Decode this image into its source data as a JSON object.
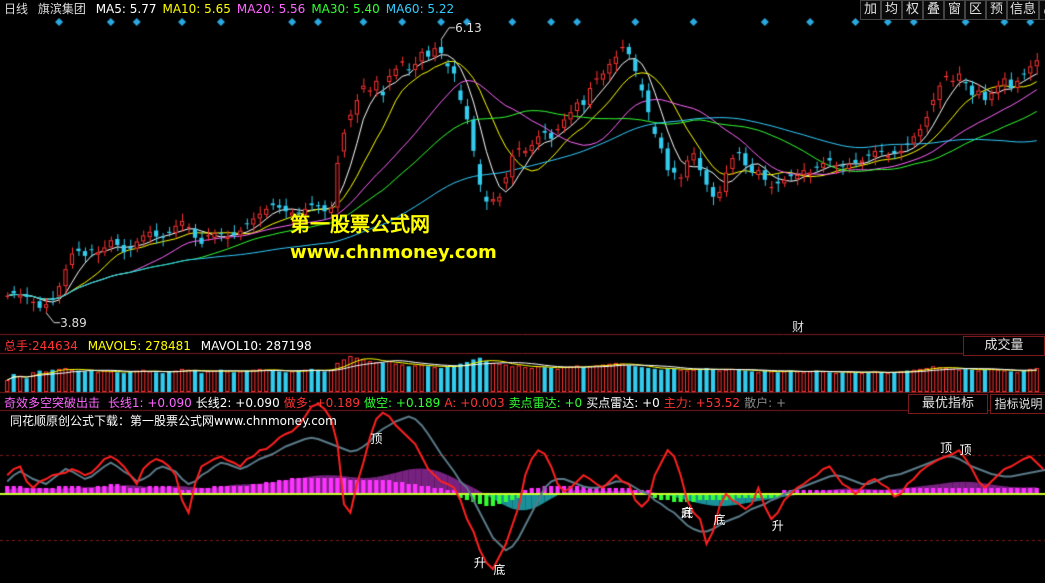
{
  "header": {
    "period": "日线",
    "stock_name": "旗滨集团",
    "ma": [
      {
        "label": "MA5:",
        "value": "5.77",
        "color": "#ffffff"
      },
      {
        "label": "MA10:",
        "value": "5.65",
        "color": "#ffff00"
      },
      {
        "label": "MA20:",
        "value": "5.56",
        "color": "#ff66ff"
      },
      {
        "label": "MA30:",
        "value": "5.40",
        "color": "#33ff33"
      },
      {
        "label": "MA60:",
        "value": "5.22",
        "color": "#33ccff"
      }
    ],
    "toolbar": [
      "加",
      "均",
      "权",
      "叠",
      "窗",
      "区",
      "预",
      "信息"
    ],
    "expand_icon": "expand-icon"
  },
  "price_panel": {
    "high_label": "6.13",
    "low_label": "3.89",
    "fin_marker": "财"
  },
  "watermark": {
    "line1": "第一股票公式网",
    "line2": "www.chnmoney.com"
  },
  "volume_header": {
    "total_label": "总手:",
    "total_value": "244634",
    "mavol5_label": "MAVOL5:",
    "mavol5_value": "278481",
    "mavol10_label": "MAVOL10:",
    "mavol10_value": "287198",
    "button": "成交量"
  },
  "indicator_header": {
    "name": "奇效多空突破出击",
    "items": [
      {
        "label": "长线1:",
        "value": "+0.090",
        "color": "#ff66ff"
      },
      {
        "label": "长线2:",
        "value": "+0.090",
        "color": "#ffffff"
      },
      {
        "label": "做多:",
        "value": "+0.189",
        "color": "#ff3333"
      },
      {
        "label": "做空:",
        "value": "+0.189",
        "color": "#33ff33"
      },
      {
        "label": "A:",
        "value": "+0.003",
        "color": "#ff3333"
      },
      {
        "label": "卖点雷达:",
        "value": "+0",
        "color": "#33ff33"
      },
      {
        "label": "买点雷达:",
        "value": "+0",
        "color": "#ffffff"
      },
      {
        "label": "主力:",
        "value": "+53.52",
        "color": "#ff3333"
      },
      {
        "label": "散户:",
        "value": "+",
        "color": "#888888"
      }
    ],
    "btn_best": "最优指标",
    "btn_explain": "指标说明"
  },
  "indicator_note": "同花顺原创公式下载：第一股票公式网www.chnmoney.com",
  "signals": [
    {
      "text": "顶",
      "i": 57
    },
    {
      "text": "升",
      "i": 73
    },
    {
      "text": "底",
      "i": 76
    },
    {
      "text": "升",
      "i": 105
    },
    {
      "text": "底",
      "i": 105
    },
    {
      "text": "底",
      "i": 110
    },
    {
      "text": "升",
      "i": 119
    },
    {
      "text": "顶",
      "i": 145
    },
    {
      "text": "顶",
      "i": 148
    }
  ],
  "chart_data": {
    "type": "candlestick",
    "up_color": "#ff3333",
    "down_color": "#33ccee",
    "x_count": 160,
    "ylim": [
      3.7,
      6.3
    ],
    "close": [
      4.0,
      4.02,
      4.01,
      3.99,
      3.95,
      3.9,
      3.93,
      3.97,
      4.08,
      4.22,
      4.35,
      4.37,
      4.33,
      4.38,
      4.36,
      4.4,
      4.46,
      4.42,
      4.36,
      4.39,
      4.45,
      4.5,
      4.53,
      4.49,
      4.48,
      4.52,
      4.58,
      4.62,
      4.57,
      4.48,
      4.43,
      4.5,
      4.52,
      4.51,
      4.49,
      4.5,
      4.54,
      4.6,
      4.64,
      4.68,
      4.72,
      4.75,
      4.73,
      4.7,
      4.69,
      4.68,
      4.72,
      4.75,
      4.74,
      4.7,
      4.73,
      5.1,
      5.35,
      5.5,
      5.62,
      5.74,
      5.7,
      5.78,
      5.66,
      5.82,
      5.88,
      5.94,
      5.87,
      5.92,
      6.02,
      5.98,
      6.05,
      6.01,
      5.9,
      5.84,
      5.62,
      5.46,
      5.2,
      4.92,
      4.78,
      4.8,
      4.82,
      4.98,
      5.16,
      5.22,
      5.2,
      5.25,
      5.32,
      5.35,
      5.3,
      5.38,
      5.46,
      5.52,
      5.6,
      5.58,
      5.72,
      5.8,
      5.84,
      5.92,
      5.98,
      6.06,
      6.0,
      5.86,
      5.7,
      5.52,
      5.34,
      5.22,
      5.04,
      5.02,
      4.98,
      5.12,
      5.18,
      5.04,
      4.92,
      4.82,
      4.86,
      5.02,
      5.14,
      5.18,
      5.08,
      5.02,
      5.04,
      4.96,
      4.9,
      4.93,
      4.96,
      4.99,
      5.0,
      5.04,
      5.02,
      5.06,
      5.1,
      5.12,
      5.08,
      5.07,
      5.09,
      5.1,
      5.12,
      5.16,
      5.2,
      5.19,
      5.16,
      5.18,
      5.2,
      5.26,
      5.32,
      5.38,
      5.48,
      5.62,
      5.74,
      5.82,
      5.78,
      5.84,
      5.76,
      5.66,
      5.7,
      5.62,
      5.68,
      5.74,
      5.8,
      5.72,
      5.78,
      5.84,
      5.9,
      5.95
    ],
    "ma_windows": [
      5,
      10,
      20,
      30,
      60
    ],
    "ma_colors": [
      "#ffffff",
      "#ffff00",
      "#ff66ff",
      "#33ff33",
      "#33ccff"
    ],
    "volume": [
      140,
      210,
      190,
      160,
      230,
      250,
      240,
      260,
      270,
      280,
      260,
      250,
      240,
      250,
      230,
      250,
      240,
      230,
      220,
      240,
      250,
      260,
      240,
      230,
      220,
      240,
      250,
      270,
      260,
      250,
      220,
      240,
      250,
      260,
      240,
      230,
      240,
      250,
      260,
      270,
      260,
      250,
      240,
      230,
      240,
      250,
      260,
      270,
      250,
      240,
      260,
      340,
      380,
      420,
      400,
      380,
      360,
      350,
      340,
      360,
      330,
      320,
      300,
      310,
      320,
      300,
      290,
      280,
      300,
      310,
      330,
      350,
      380,
      400,
      360,
      340,
      330,
      320,
      300,
      310,
      290,
      280,
      300,
      290,
      280,
      270,
      290,
      300,
      310,
      290,
      300,
      310,
      320,
      330,
      340,
      330,
      310,
      300,
      290,
      280,
      270,
      260,
      280,
      270,
      260,
      250,
      260,
      270,
      280,
      260,
      250,
      260,
      270,
      260,
      250,
      240,
      230,
      250,
      240,
      230,
      240,
      250,
      240,
      230,
      240,
      250,
      240,
      230,
      220,
      230,
      240,
      230,
      220,
      230,
      240,
      230,
      220,
      230,
      240,
      250,
      260,
      270,
      280,
      300,
      290,
      280,
      270,
      260,
      270,
      260,
      250,
      260,
      270,
      260,
      250,
      240,
      230,
      250,
      270,
      280
    ],
    "indicator": {
      "red_line": [
        15,
        20,
        22,
        10,
        5,
        10,
        12,
        15,
        16,
        17,
        20,
        18,
        15,
        17,
        22,
        28,
        30,
        27,
        22,
        15,
        8,
        20,
        25,
        28,
        26,
        22,
        15,
        -5,
        -15,
        8,
        22,
        25,
        28,
        30,
        27,
        25,
        22,
        28,
        30,
        35,
        36,
        40,
        45,
        48,
        50,
        55,
        62,
        70,
        72,
        68,
        60,
        40,
        -8,
        -15,
        8,
        25,
        45,
        60,
        65,
        62,
        55,
        50,
        45,
        40,
        30,
        20,
        15,
        10,
        8,
        5,
        -5,
        -20,
        -30,
        -45,
        -55,
        -60,
        -50,
        -40,
        -25,
        -10,
        15,
        28,
        35,
        32,
        22,
        8,
        2,
        5,
        10,
        15,
        12,
        8,
        5,
        10,
        15,
        10,
        8,
        -5,
        -10,
        -5,
        15,
        25,
        35,
        30,
        15,
        -5,
        -15,
        -20,
        -40,
        -30,
        -10,
        0,
        -5,
        -8,
        -12,
        -8,
        5,
        -10,
        -20,
        -15,
        -5,
        0,
        5,
        8,
        12,
        15,
        20,
        22,
        15,
        8,
        5,
        0,
        5,
        10,
        12,
        8,
        5,
        -2,
        0,
        8,
        12,
        18,
        22,
        25,
        28,
        30,
        32,
        35,
        28,
        20,
        10,
        5,
        10,
        15,
        20,
        22,
        25,
        28,
        30,
        25,
        20
      ],
      "gray_line": [
        10,
        15,
        18,
        15,
        12,
        10,
        8,
        12,
        16,
        20,
        18,
        15,
        12,
        14,
        18,
        22,
        25,
        22,
        18,
        15,
        10,
        12,
        15,
        20,
        22,
        20,
        18,
        12,
        8,
        10,
        15,
        18,
        22,
        25,
        24,
        22,
        20,
        22,
        25,
        28,
        30,
        32,
        35,
        38,
        40,
        42,
        44,
        45,
        44,
        42,
        40,
        38,
        36,
        34,
        35,
        38,
        42,
        48,
        52,
        55,
        58,
        60,
        62,
        60,
        55,
        48,
        40,
        32,
        25,
        18,
        10,
        5,
        -5,
        -15,
        -25,
        -35,
        -40,
        -45,
        -42,
        -35,
        -25,
        -15,
        -5,
        5,
        10,
        12,
        12,
        10,
        8,
        6,
        5,
        5,
        6,
        8,
        10,
        10,
        8,
        5,
        2,
        0,
        -5,
        -8,
        -12,
        -15,
        -20,
        -25,
        -28,
        -30,
        -30,
        -28,
        -25,
        -22,
        -20,
        -18,
        -15,
        -12,
        -10,
        -8,
        -5,
        -3,
        0,
        2,
        4,
        6,
        8,
        10,
        12,
        14,
        15,
        14,
        12,
        10,
        8,
        8,
        10,
        12,
        14,
        15,
        16,
        18,
        20,
        22,
        24,
        26,
        28,
        30,
        30,
        28,
        25,
        22,
        20,
        18,
        16,
        15,
        14,
        14,
        15,
        16,
        17,
        18,
        19,
        20
      ],
      "hist": [
        4,
        4,
        4,
        3,
        3,
        3,
        3,
        3,
        4,
        4,
        4,
        4,
        3,
        3,
        4,
        4,
        5,
        5,
        4,
        3,
        3,
        3,
        4,
        4,
        4,
        4,
        3,
        2,
        2,
        3,
        3,
        3,
        4,
        4,
        4,
        4,
        4,
        4,
        5,
        5,
        6,
        6,
        7,
        7,
        8,
        8,
        8,
        8,
        8,
        8,
        8,
        8,
        8,
        7,
        7,
        7,
        7,
        7,
        7,
        7,
        6,
        6,
        5,
        5,
        4,
        4,
        3,
        3,
        2,
        2,
        -2,
        -3,
        -4,
        -5,
        -6,
        -6,
        -5,
        -4,
        -3,
        -2,
        2,
        3,
        3,
        4,
        4,
        4,
        4,
        4,
        4,
        4,
        3,
        3,
        3,
        3,
        3,
        3,
        3,
        2,
        2,
        2,
        -2,
        -3,
        -3,
        -4,
        -4,
        -4,
        -4,
        -3,
        -3,
        -3,
        -3,
        -3,
        -3,
        -2,
        -2,
        -2,
        -2,
        -2,
        -2,
        -2,
        2,
        2,
        2,
        2,
        2,
        2,
        2,
        2,
        2,
        2,
        2,
        2,
        2,
        2,
        2,
        2,
        2,
        2,
        2,
        3,
        3,
        3,
        3,
        3,
        3,
        3,
        3,
        3,
        3,
        3,
        3,
        3,
        3,
        3,
        3,
        3,
        3,
        3,
        3,
        3
      ],
      "zero_label": "0"
    }
  }
}
